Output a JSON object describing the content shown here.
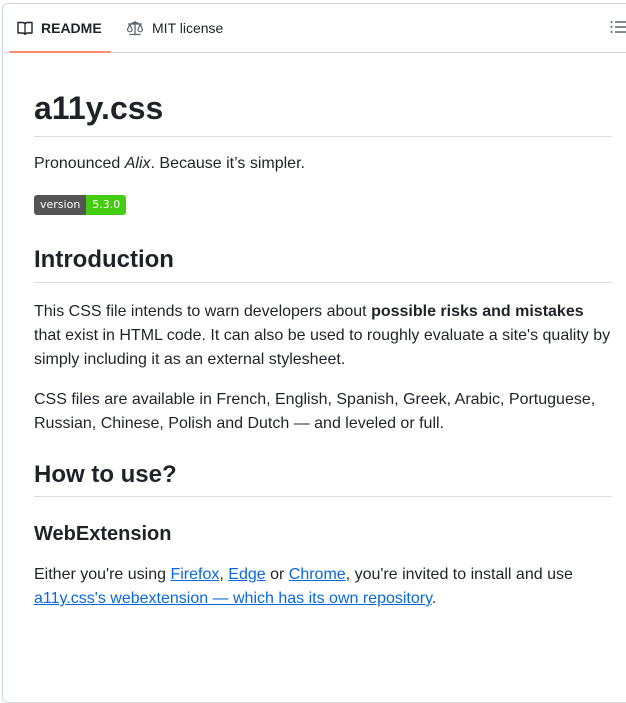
{
  "tabs": {
    "readme": "README",
    "license": "MIT license"
  },
  "readme": {
    "title": "a11y.css",
    "pronounced_prefix": "Pronounced ",
    "pronounced_name": "Alix",
    "pronounced_suffix": ". Because it’s simpler.",
    "badge": {
      "label": "version",
      "value": "5.3.0",
      "label_color": "#555555",
      "value_color": "#44cc11"
    },
    "intro_heading": "Introduction",
    "intro_p1_a": "This CSS file intends to warn developers about ",
    "intro_p1_bold": "possible risks and mistakes",
    "intro_p1_b": " that exist in HTML code. It can also be used to roughly evaluate a site's quality by simply including it as an external stylesheet.",
    "intro_p2": "CSS files are available in French, English, Spanish, Greek, Arabic, Portuguese, Russian, Chinese, Polish and Dutch — and leveled or full.",
    "howto_heading": "How to use?",
    "webext_heading": "WebExtension",
    "webext_p_a": "Either you're using ",
    "link_firefox": "Firefox",
    "comma": ", ",
    "link_edge": "Edge",
    "or_text": " or ",
    "link_chrome": "Chrome",
    "webext_p_b": ", you're invited to install and use ",
    "link_webext": "a11y.css's webextension — which has its own repository",
    "period": "."
  },
  "colors": {
    "accent": "#fd8c73",
    "link": "#0969da",
    "border": "#d0d7de"
  },
  "icons": {
    "readme": "book-icon",
    "license": "law-scale-icon",
    "outline": "list-unordered-icon"
  }
}
